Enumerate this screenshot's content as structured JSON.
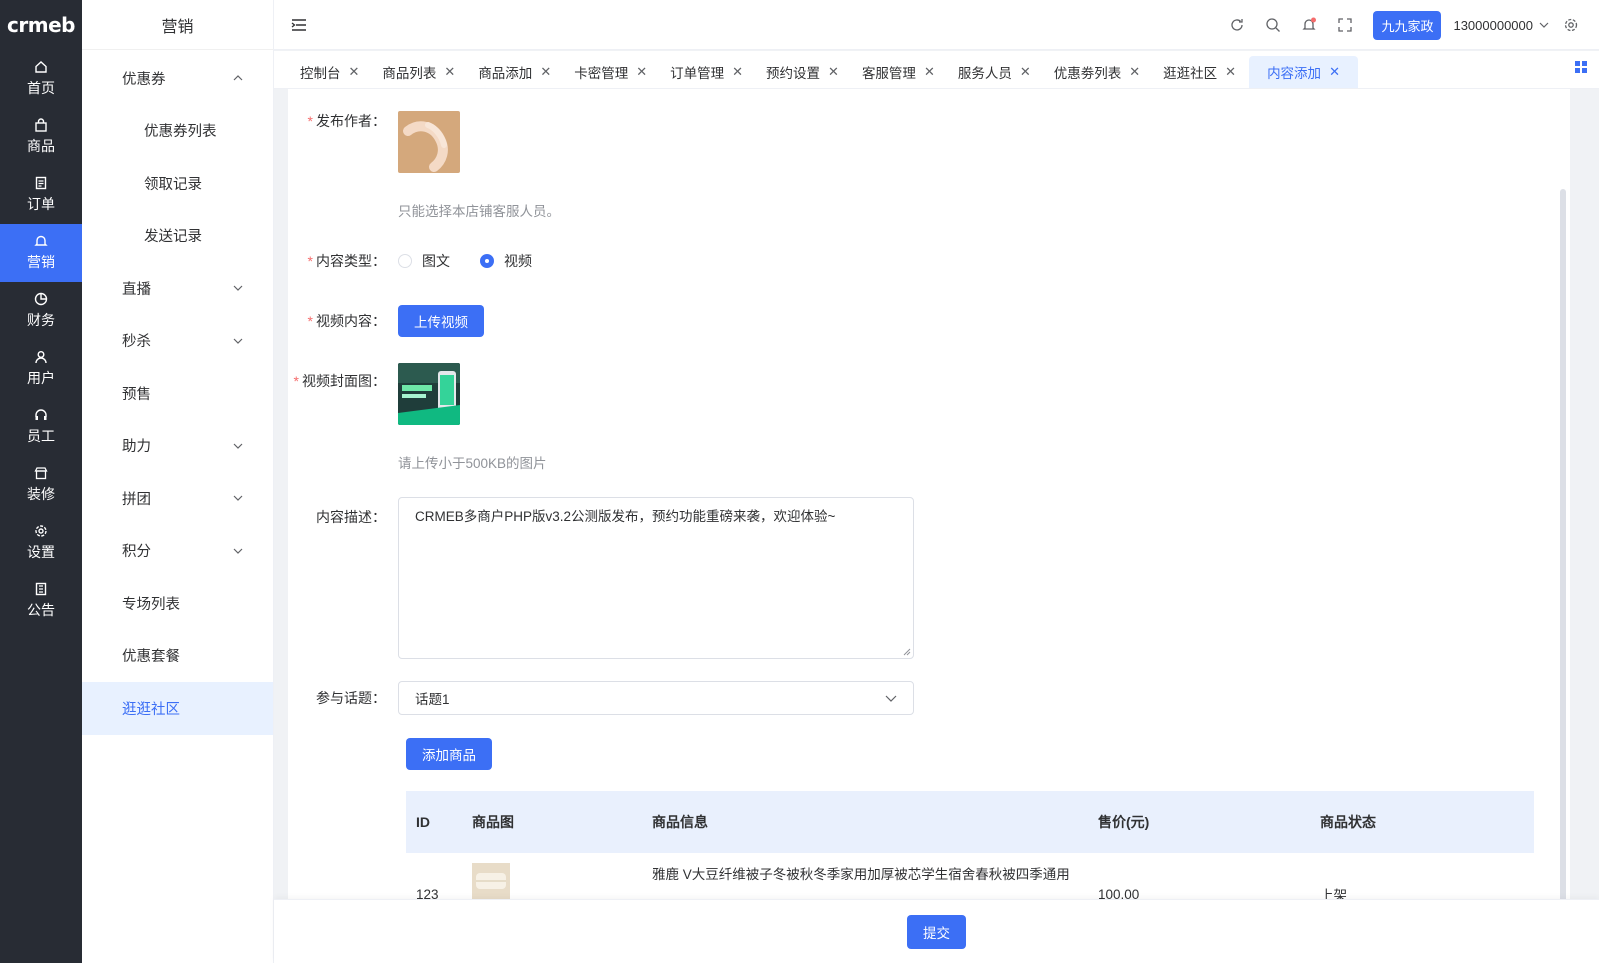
{
  "brand": {
    "logo_text": "crmeb"
  },
  "rail": [
    {
      "label": "首页",
      "icon": "home-icon"
    },
    {
      "label": "商品",
      "icon": "bag-icon"
    },
    {
      "label": "订单",
      "icon": "order-icon"
    },
    {
      "label": "营销",
      "icon": "bell-icon"
    },
    {
      "label": "财务",
      "icon": "pie-icon"
    },
    {
      "label": "用户",
      "icon": "user-icon"
    },
    {
      "label": "员工",
      "icon": "headset-icon"
    },
    {
      "label": "装修",
      "icon": "store-icon"
    },
    {
      "label": "设置",
      "icon": "gear-icon"
    },
    {
      "label": "公告",
      "icon": "notice-icon"
    }
  ],
  "submenu": {
    "title": "营销",
    "items": [
      {
        "label": "优惠券"
      },
      {
        "label": "优惠券列表"
      },
      {
        "label": "领取记录"
      },
      {
        "label": "发送记录"
      },
      {
        "label": "直播"
      },
      {
        "label": "秒杀"
      },
      {
        "label": "预售"
      },
      {
        "label": "助力"
      },
      {
        "label": "拼团"
      },
      {
        "label": "积分"
      },
      {
        "label": "专场列表"
      },
      {
        "label": "优惠套餐"
      },
      {
        "label": "逛逛社区"
      }
    ]
  },
  "header": {
    "store": "九九家政",
    "phone": "13000000000"
  },
  "tabs": [
    {
      "label": "控制台"
    },
    {
      "label": "商品列表"
    },
    {
      "label": "商品添加"
    },
    {
      "label": "卡密管理"
    },
    {
      "label": "订单管理"
    },
    {
      "label": "预约设置"
    },
    {
      "label": "客服管理"
    },
    {
      "label": "服务人员"
    },
    {
      "label": "优惠劵列表"
    },
    {
      "label": "逛逛社区"
    },
    {
      "label": "内容添加"
    }
  ],
  "form": {
    "author_label": "发布作者：",
    "author_hint": "只能选择本店铺客服人员。",
    "type_label": "内容类型：",
    "type_option_1": "图文",
    "type_option_2": "视频",
    "video_label": "视频内容：",
    "upload_video": "上传视频",
    "cover_label": "视频封面图：",
    "cover_hint": "请上传小于500KB的图片",
    "desc_label": "内容描述：",
    "desc_value": "CRMEB多商户PHP版v3.2公测版发布，预约功能重磅来袭，欢迎体验~",
    "topic_label": "参与话题：",
    "topic_value": "话题1",
    "add_product": "添加商品"
  },
  "table": {
    "headers": {
      "id": "ID",
      "img": "商品图",
      "info": "商品信息",
      "price": "售价(元)",
      "status": "商品状态"
    },
    "rows": [
      {
        "id": "123",
        "info": "雅鹿 V大豆纤维被子冬被秋冬季家用加厚被芯学生宿舍春秋被四季通用",
        "price": "100.00",
        "status": "上架"
      }
    ]
  },
  "footer": {
    "submit": "提交"
  },
  "colors": {
    "accent": "#3c6ff5",
    "rail_bg": "#282c34",
    "required": "#f56c6c"
  }
}
